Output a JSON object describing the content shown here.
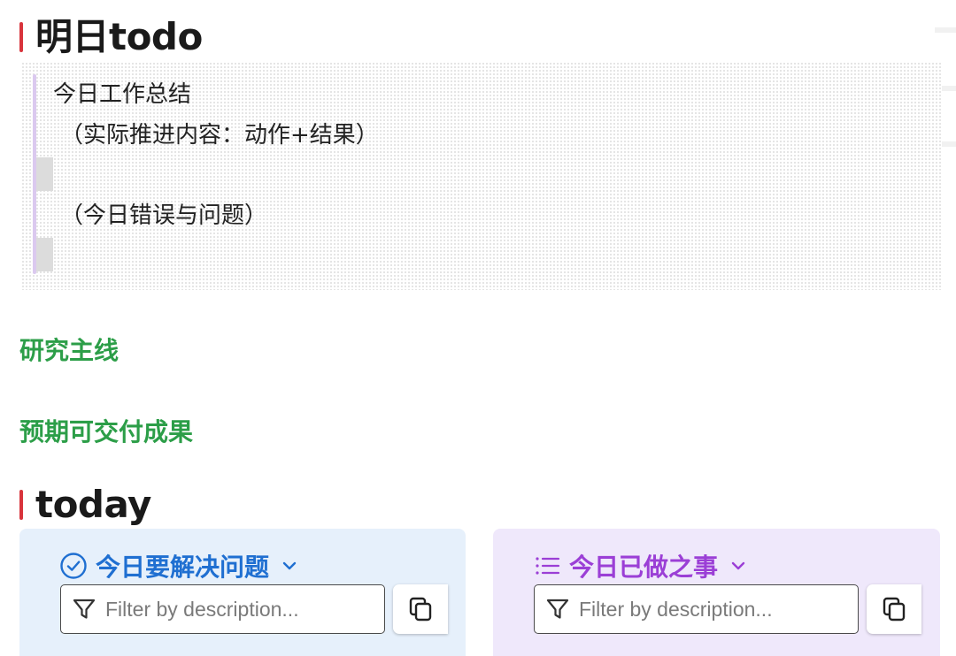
{
  "heading_tomorrow": "明日todo",
  "callout": {
    "line1": "今日工作总结",
    "line2": "（实际推进内容：动作+结果）",
    "line3": "（今日错误与问题）"
  },
  "sections": {
    "research": "研究主线",
    "deliverables": "预期可交付成果"
  },
  "heading_today": "today",
  "panels": {
    "left": {
      "title": "今日要解决问题",
      "icon": "check-circle-icon",
      "color": "#1f6fd1",
      "filter_placeholder": "Filter by description..."
    },
    "right": {
      "title": "今日已做之事",
      "icon": "list-icon",
      "color": "#9b3fd6",
      "filter_placeholder": "Filter by description..."
    }
  },
  "colors": {
    "heading_accent": "#d8343c",
    "section_green": "#2c9e48",
    "panel_blue_bg": "#e6f0fb",
    "panel_purple_bg": "#efe8fb"
  }
}
